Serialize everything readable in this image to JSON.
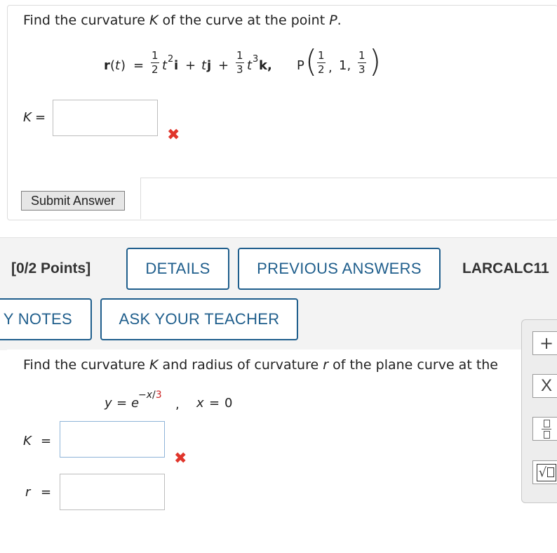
{
  "problem1": {
    "question": "Find the curvature K of the curve at the point P.",
    "question_parts": [
      "Find the curvature ",
      "K",
      " of the curve at the point ",
      "P",
      "."
    ],
    "equation": {
      "r_label": "r",
      "t": "t",
      "paren_open": "(",
      "paren_close": ")",
      "equals": "=",
      "frac1_num": "1",
      "frac1_den": "2",
      "t2": "t",
      "exp2": "2",
      "i": "i",
      "plus1": "+",
      "tj_t": "t",
      "tj_j": "j",
      "plus2": "+",
      "frac2_num": "1",
      "frac2_den": "3",
      "t3": "t",
      "exp3": "3",
      "k": "k,",
      "P": "P",
      "pfrac1_num": "1",
      "pfrac1_den": "2",
      "comma1": ",",
      "mid": "1,",
      "pfrac2_num": "1",
      "pfrac2_den": "3"
    },
    "K_label": "K",
    "K_eq": "=",
    "K_value": "",
    "submit_label": "Submit Answer"
  },
  "problem2": {
    "points": "[0/2 Points]",
    "details_label": "DETAILS",
    "previous_answers_label": "PREVIOUS ANSWERS",
    "source": "LARCALC11",
    "notes_label": "Y NOTES",
    "ask_teacher_label": "ASK YOUR TEACHER",
    "question_parts": [
      "Find the curvature ",
      "K",
      " and radius of curvature ",
      "r",
      " of the plane curve at the "
    ],
    "eq_y": "y",
    "eq_equals": "=",
    "eq_e": "e",
    "eq_exp_neg": "−",
    "eq_exp_x": "x",
    "eq_exp_slash": "/",
    "eq_exp_3": "3",
    "eq_comma": ",",
    "eq_x": "x",
    "eq_x_equals": "=",
    "eq_x_value": "0",
    "K_label": "K",
    "K_eq": "=",
    "K_value": "",
    "r_label": "r",
    "r_eq": "=",
    "r_value": ""
  },
  "tools": {
    "plus": "+",
    "times": "X",
    "sqrt": "√"
  },
  "colors": {
    "accent": "#1f5e8c",
    "error": "#e0352b",
    "exponent_red": "#cc2222"
  }
}
